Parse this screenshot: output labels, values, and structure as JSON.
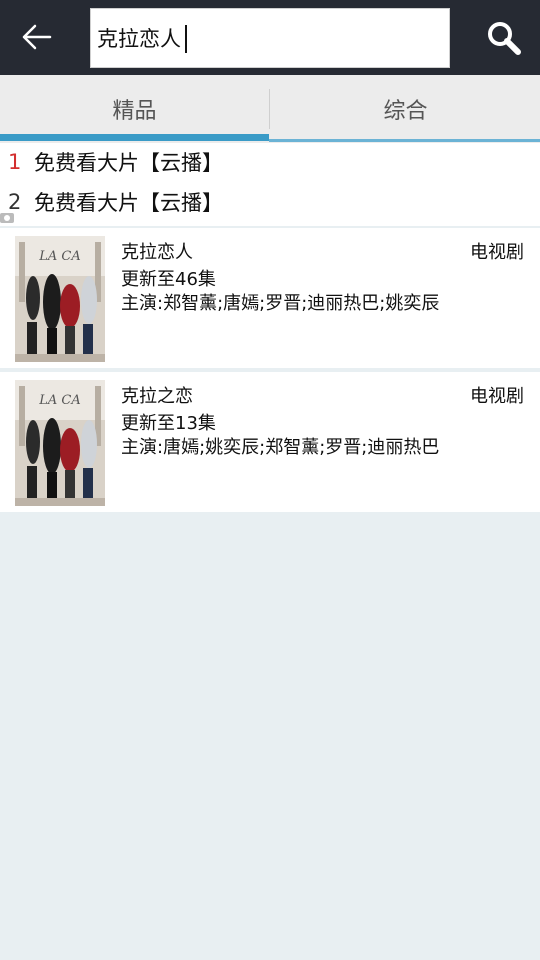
{
  "search": {
    "query": "克拉恋人"
  },
  "tabs": [
    {
      "label": "精品",
      "active": true
    },
    {
      "label": "综合",
      "active": false
    }
  ],
  "colors": {
    "accent": "#3a9bc7",
    "topbar": "#262a33",
    "rank_highlight": "#d32f2f"
  },
  "suggestions": [
    {
      "rank": "1",
      "text": "免费看大片【云播】"
    },
    {
      "rank": "2",
      "text": "免费看大片【云播】"
    }
  ],
  "results": [
    {
      "title": "克拉恋人",
      "update": "更新至46集",
      "cast": "主演:郑智薰;唐嫣;罗晋;迪丽热巴;姚奕辰",
      "type": "电视剧"
    },
    {
      "title": "克拉之恋",
      "update": "更新至13集",
      "cast": "主演:唐嫣;姚奕辰;郑智薰;罗晋;迪丽热巴",
      "type": "电视剧"
    }
  ]
}
